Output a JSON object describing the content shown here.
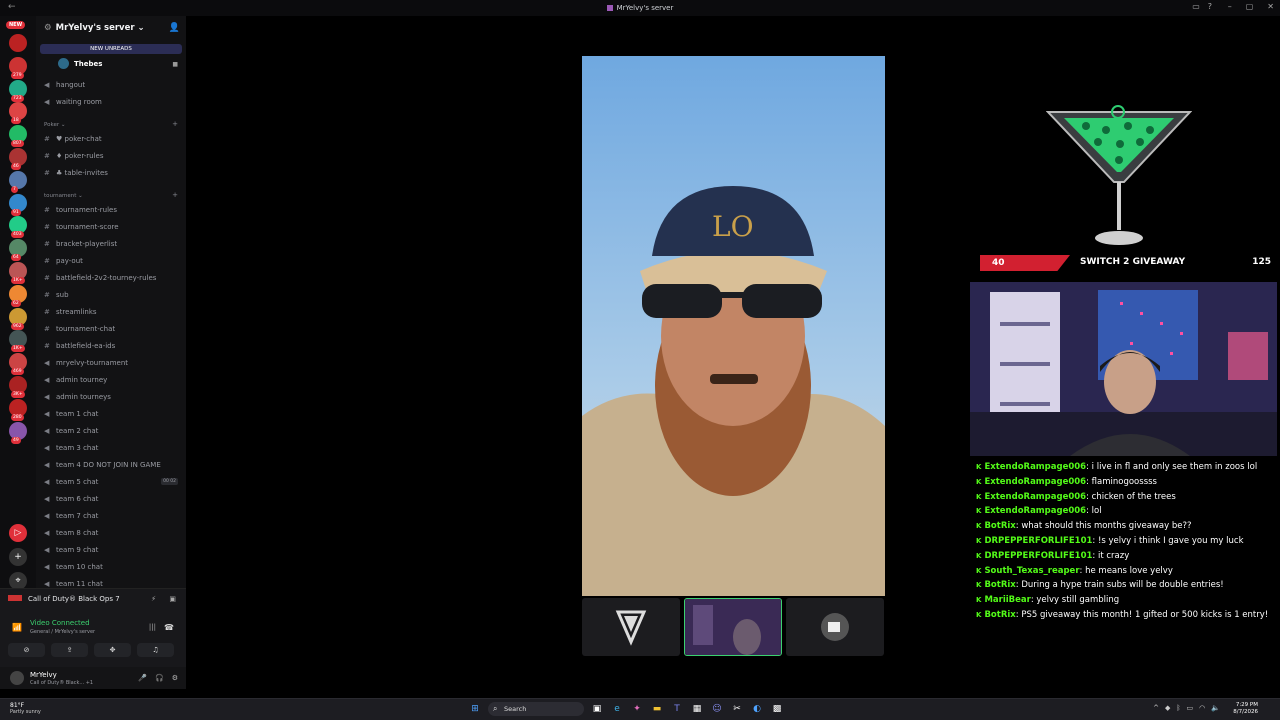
{
  "window": {
    "title": "MrYelvy's server"
  },
  "rail": {
    "new_label": "NEW",
    "badges": [
      "279",
      "723",
      "18",
      "807",
      "46",
      "7",
      "91",
      "403",
      "64",
      "1K+",
      "62",
      "962",
      "1K+",
      "469",
      "3K+",
      "280",
      "49"
    ]
  },
  "sidebar": {
    "server_name": "MrYelvy's server ⌄",
    "new_unreads": "NEW UNREADS",
    "active_user": "Thebes",
    "channels_top": [
      {
        "sym": "🔊",
        "label": "hangout"
      },
      {
        "sym": "🔊",
        "label": "waiting room"
      }
    ],
    "cat_poker": "Poker ⌄",
    "poker_channels": [
      {
        "sym": "#",
        "label": "♥ poker-chat"
      },
      {
        "sym": "#",
        "label": "♦ poker-rules"
      },
      {
        "sym": "#",
        "label": "♣ table-invites"
      }
    ],
    "cat_tournament": "tournament ⌄",
    "tournament_channels": [
      {
        "sym": "#",
        "label": "tournament-rules"
      },
      {
        "sym": "#",
        "label": "tournament-score"
      },
      {
        "sym": "#",
        "label": "bracket-playerlist"
      },
      {
        "sym": "#",
        "label": "pay-out"
      },
      {
        "sym": "#",
        "label": "battlefield-2v2-tourney-rules"
      },
      {
        "sym": "#",
        "label": "sub"
      },
      {
        "sym": "#",
        "label": "streamlinks"
      },
      {
        "sym": "#",
        "label": "tournament-chat"
      },
      {
        "sym": "#",
        "label": "battlefield-ea-ids"
      },
      {
        "sym": "🔊",
        "label": "mryelvy-tournament"
      },
      {
        "sym": "🔊",
        "label": "admin tourney"
      },
      {
        "sym": "🔊",
        "label": "admin tourneys"
      },
      {
        "sym": "🔊",
        "label": "team 1 chat"
      },
      {
        "sym": "🔊",
        "label": "team 2 chat"
      },
      {
        "sym": "🔊",
        "label": "team 3 chat"
      },
      {
        "sym": "🔊",
        "label": "team 4 DO NOT JOIN IN GAME"
      },
      {
        "sym": "🔊",
        "label": "team 5 chat"
      },
      {
        "sym": "🔊",
        "label": "team 6 chat"
      },
      {
        "sym": "🔊",
        "label": "team 7 chat"
      },
      {
        "sym": "🔊",
        "label": "team 8 chat"
      },
      {
        "sym": "🔊",
        "label": "team 9 chat"
      },
      {
        "sym": "🔊",
        "label": "team 10 chat"
      },
      {
        "sym": "🔊",
        "label": "team 11 chat"
      }
    ],
    "team5_tags": "00 02"
  },
  "voice_panel": {
    "game": "Call of Duty® Black Ops 7",
    "status": "Video Connected",
    "location": "General / MrYelvy's server"
  },
  "user": {
    "name": "MrYelvy",
    "status": "Call of Duty® Black... +1"
  },
  "giveaway": {
    "left_count": "40",
    "title": "SWITCH 2 GIVEAWAY",
    "right_count": "125"
  },
  "chat": [
    {
      "user": "ExtendoRampage006",
      "msg": "i live in fl and only see them in zoos lol"
    },
    {
      "user": "ExtendoRampage006",
      "msg": "flaminogoossss"
    },
    {
      "user": "ExtendoRampage006",
      "msg": "chicken of the trees"
    },
    {
      "user": "ExtendoRampage006",
      "msg": "lol"
    },
    {
      "user": "BotRix",
      "msg": "what should this months giveaway be??"
    },
    {
      "user": "DRPEPPERFORLIFE101",
      "msg": "!s yelvy i think I gave you my luck"
    },
    {
      "user": "DRPEPPERFORLIFE101",
      "msg": "it crazy"
    },
    {
      "user": "South_Texas_reaper",
      "msg": "he means love yelvy"
    },
    {
      "user": "BotRix",
      "msg": "During a hype train subs will be double entries!"
    },
    {
      "user": "MariiBear",
      "msg": "yelvy still gambling"
    },
    {
      "user": "BotRix",
      "msg": "PS5 giveaway this month! 1 gifted or 500 kicks is 1 entry!"
    }
  ],
  "taskbar": {
    "temp": "81°F",
    "weather": "Partly sunny",
    "search": "Search",
    "time": "7:29 PM",
    "date": "8/7/2026"
  },
  "colors": {
    "accent_green": "#53fc18",
    "discord_red": "#e0303a",
    "voice_green": "#3bd16f"
  }
}
